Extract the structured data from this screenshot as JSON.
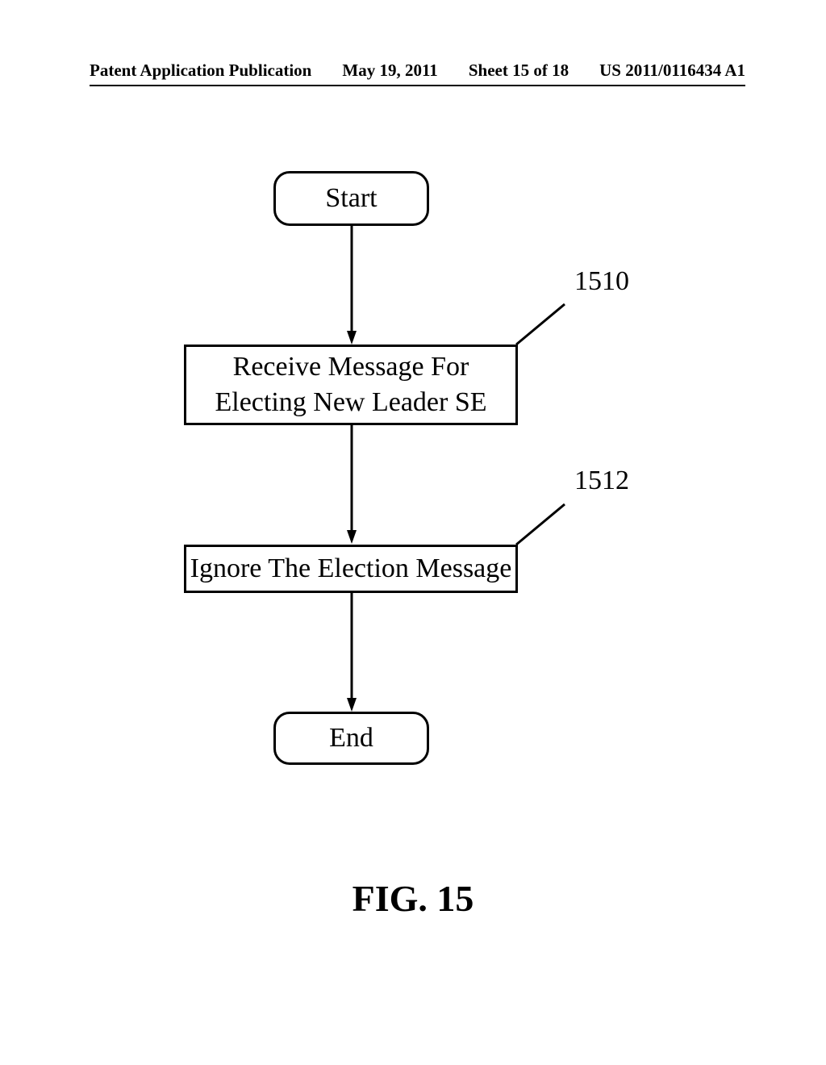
{
  "header": {
    "pub_type": "Patent Application Publication",
    "date": "May 19, 2011",
    "sheet": "Sheet 15 of 18",
    "pub_number": "US 2011/0116434 A1"
  },
  "flowchart": {
    "start": "Start",
    "step1": "Receive Message For\nElecting New Leader SE",
    "step2": "Ignore The Election Message",
    "end": "End",
    "ref1": "1510",
    "ref2": "1512"
  },
  "figure_label": "FIG. 15"
}
